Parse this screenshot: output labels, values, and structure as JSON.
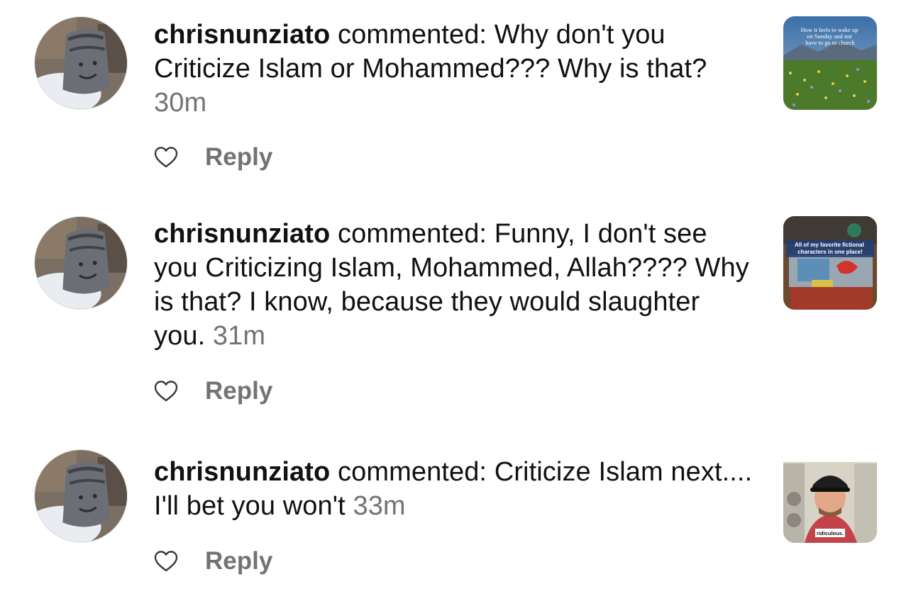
{
  "comments": [
    {
      "username": "chrisnunziato",
      "verb": "commented:",
      "text": "Why don't you Criticize Islam or Mohammed??? Why is that?",
      "time": "30m",
      "reply_label": "Reply",
      "thumbnail": {
        "icon": "meadow-thumbnail",
        "caption": "How it feels to wake up on Sunday and not have to go to church"
      }
    },
    {
      "username": "chrisnunziato",
      "verb": "commented:",
      "text": "Funny, I don't see you Criticizing Islam, Mohammed, Allah???? Why is that?  I know, because they would slaughter you.",
      "time": "31m",
      "reply_label": "Reply",
      "thumbnail": {
        "icon": "figurines-thumbnail",
        "caption": "All of my favorite fictional characters in one place!"
      }
    },
    {
      "username": "chrisnunziato",
      "verb": "commented:",
      "text": "Criticize Islam next.... I'll bet you won't",
      "time": "33m",
      "reply_label": "Reply",
      "thumbnail": {
        "icon": "man-selfie-thumbnail",
        "caption": "ridiculous."
      }
    }
  ],
  "colors": {
    "text": "#111111",
    "muted": "#737373",
    "background": "#ffffff"
  },
  "icons": {
    "like": "heart-outline-icon",
    "avatar": "profile-photo"
  }
}
